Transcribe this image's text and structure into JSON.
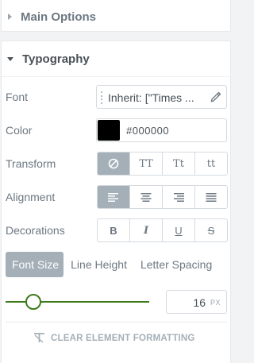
{
  "sections": {
    "main_options": {
      "title": "Main Options",
      "expanded": false
    },
    "typography": {
      "title": "Typography",
      "expanded": true
    }
  },
  "fields": {
    "font": {
      "label": "Font",
      "value": "Inherit: [\"Times ...",
      "icon": "pencil-icon"
    },
    "color": {
      "label": "Color",
      "value": "#000000",
      "swatch": "#000000"
    },
    "transform": {
      "label": "Transform",
      "options": [
        "none",
        "TT",
        "Tt",
        "tt"
      ],
      "selected": "none"
    },
    "alignment": {
      "label": "Alignment",
      "options": [
        "align-left",
        "align-center",
        "align-right",
        "justify"
      ],
      "selected": "align-left"
    },
    "decorations": {
      "label": "Decorations",
      "options": [
        "B",
        "I",
        "U",
        "S"
      ]
    }
  },
  "tabs": [
    {
      "label": "Font Size",
      "active": true
    },
    {
      "label": "Line Height",
      "active": false
    },
    {
      "label": "Letter Spacing",
      "active": false
    }
  ],
  "font_size": {
    "value": "16",
    "unit": "PX",
    "slider_fraction": 0.14
  },
  "clear_button": {
    "label": "CLEAR ELEMENT FORMATTING",
    "icon": "clear-format-icon"
  },
  "colors": {
    "accent": "#3c7a1b",
    "active_button": "#a4afb7",
    "border": "#d5dadf"
  }
}
